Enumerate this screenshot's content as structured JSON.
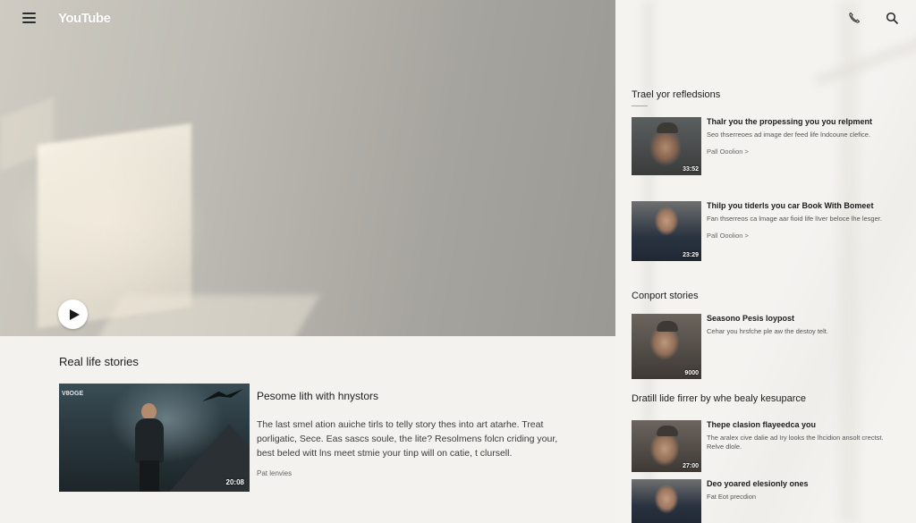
{
  "header": {
    "logo": "YouTube"
  },
  "hero": {
    "play_label": "play"
  },
  "main": {
    "section_title": "Real life stories",
    "featured": {
      "thumb_tag": "V8OGE",
      "duration": "20:08",
      "title": "Pesome lith with hnystors",
      "description": "The last smel ation auiche tirls to telly story thes into art atarhe. Treat porligatic, Sece. Eas sascs soule, the lite? Resolmens folcn criding your, best beled witt lns meet stmie your tinp will on catie, t clursell.",
      "meta": "Pat lenvies"
    }
  },
  "sidebar": {
    "sections": [
      {
        "title": "Trael yor refledsions",
        "items": [
          {
            "title": "Thalr you the propessing you you relpment",
            "description": "Seo thserreoes ad image der feed life lndcoune clefice.",
            "link": "Pall Ooolion >",
            "duration": "33:52"
          },
          {
            "title": "Thilp you tiderls you car Book With Bomeet",
            "description": "Fan thserreos ca lmage aar fioid life lIver beloce lhe lesger.",
            "link": "Pall Ooolion >",
            "duration": "23:29"
          }
        ]
      },
      {
        "title": "Conport stories",
        "items": [
          {
            "title": "Seasono Pesis loypost",
            "description": "Cehar you hrsfche ple aw the destoy telt.",
            "link": "",
            "duration": "9000"
          }
        ]
      },
      {
        "title": "Dratill lide firrer by whe bealy kesuparce",
        "items": [
          {
            "title": "Thepe clasion flayeedca you",
            "description": "The aralex cive dalie ad Iry looks the lhcidion ansolt crectst. Relve dlole.",
            "link": "",
            "duration": "27:00"
          },
          {
            "title": "Deo yoared elesionly ones",
            "description": "Fat Eot precdion",
            "link": "",
            "duration": ""
          }
        ]
      }
    ]
  }
}
